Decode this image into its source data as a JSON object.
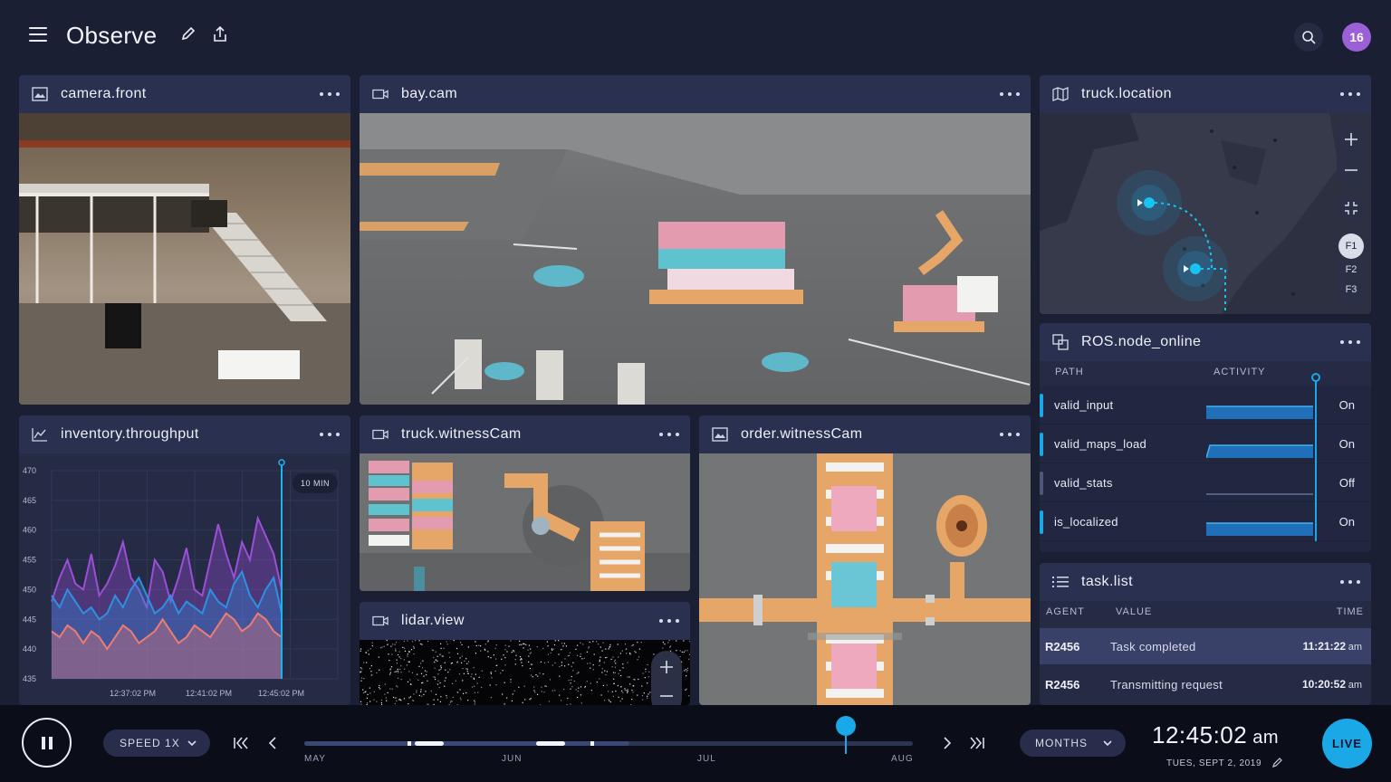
{
  "app": {
    "title": "Observe",
    "avatar_badge": "16"
  },
  "icons": {
    "menu": "hamburger-icon",
    "edit": "pencil-icon",
    "share": "share-icon",
    "search": "search-icon",
    "image": "image-icon",
    "video": "video-camera-icon",
    "map": "map-icon",
    "chart": "line-chart-icon",
    "nodes": "nodes-icon",
    "list": "list-icon",
    "more": "more-icon"
  },
  "colors": {
    "accent": "#19a8e8",
    "background": "#1b1f33",
    "panel": "#252a45",
    "avatar": "#9b5fd6"
  },
  "panels": {
    "camera_front": {
      "title": "camera.front"
    },
    "bay_cam": {
      "title": "bay.cam"
    },
    "truck_location": {
      "title": "truck.location",
      "floors": [
        "F1",
        "F2",
        "F3"
      ],
      "selected_floor": "F1"
    },
    "ros": {
      "title": "ROS.node_online",
      "columns": {
        "path": "PATH",
        "activity": "ACTIVITY"
      },
      "rows": [
        {
          "path": "valid_input",
          "state": "On",
          "active": true
        },
        {
          "path": "valid_maps_load",
          "state": "On",
          "active": true
        },
        {
          "path": "valid_stats",
          "state": "Off",
          "active": false
        },
        {
          "path": "is_localized",
          "state": "On",
          "active": true
        }
      ]
    },
    "inventory": {
      "title": "inventory.throughput",
      "window_badge": "10 MIN"
    },
    "truck_witness": {
      "title": "truck.witnessCam"
    },
    "order_witness": {
      "title": "order.witnessCam"
    },
    "lidar": {
      "title": "lidar.view"
    },
    "tasks": {
      "title": "task.list",
      "columns": {
        "agent": "AGENT",
        "value": "VALUE",
        "time": "TIME"
      },
      "rows": [
        {
          "agent": "R2456",
          "value": "Task completed",
          "time": "11:21:22",
          "ampm": "am",
          "highlight": true
        },
        {
          "agent": "R2456",
          "value": "Transmitting request",
          "time": "10:20:52",
          "ampm": "am",
          "highlight": false
        }
      ]
    }
  },
  "chart_data": {
    "type": "area",
    "title": "",
    "xlabel": "",
    "ylabel": "",
    "ylim": [
      435,
      470
    ],
    "yticks": [
      470,
      465,
      460,
      455,
      450,
      445,
      440,
      435
    ],
    "xtick_labels": [
      "12:37:02 PM",
      "12:41:02 PM",
      "12:45:02 PM"
    ],
    "grid": true,
    "series": [
      {
        "color": "#9b4fd6",
        "values": [
          448,
          452,
          455,
          451,
          450,
          456,
          449,
          451,
          454,
          458,
          452,
          450,
          447,
          455,
          453,
          448,
          452,
          457,
          450,
          449,
          455,
          461,
          456,
          452,
          458,
          455,
          462,
          459,
          456,
          450
        ]
      },
      {
        "color": "#2f8fe0",
        "values": [
          449,
          447,
          450,
          448,
          446,
          447,
          445,
          446,
          449,
          447,
          450,
          452,
          449,
          446,
          447,
          449,
          446,
          448,
          447,
          446,
          450,
          448,
          447,
          451,
          453,
          449,
          447,
          450,
          452,
          446
        ]
      },
      {
        "color": "#ee7c74",
        "values": [
          443,
          442,
          444,
          443,
          441,
          443,
          442,
          440,
          442,
          444,
          443,
          441,
          442,
          443,
          445,
          443,
          441,
          442,
          444,
          443,
          442,
          444,
          446,
          445,
          443,
          444,
          446,
          445,
          443,
          442
        ]
      }
    ]
  },
  "playback": {
    "speed_label": "SPEED 1X",
    "range_label": "MONTHS",
    "months": [
      "MAY",
      "JUN",
      "JUL",
      "AUG"
    ],
    "progress": 0.89,
    "time": "12:45:02",
    "time_ampm": "am",
    "date": "TUES, SEPT 2, 2019",
    "live_label": "LIVE"
  }
}
